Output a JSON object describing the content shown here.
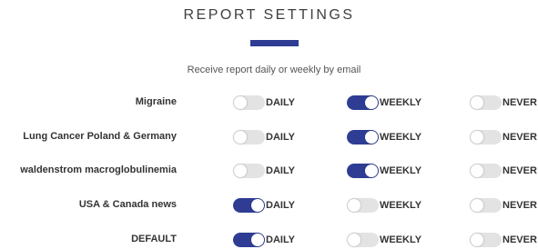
{
  "header": {
    "title": "REPORT SETTINGS",
    "subtitle": "Receive report daily or weekly by email"
  },
  "colors": {
    "accent": "#2e3d93",
    "toggle_on": "#2e3d93",
    "toggle_off": "#e3e3e3"
  },
  "options": [
    "DAILY",
    "WEEKLY",
    "NEVER"
  ],
  "rows": [
    {
      "label": "Migraine",
      "selected": "WEEKLY"
    },
    {
      "label": "Lung Cancer Poland & Germany",
      "selected": "WEEKLY"
    },
    {
      "label": "waldenstrom macroglobulinemia",
      "selected": "WEEKLY"
    },
    {
      "label": "USA & Canada news",
      "selected": "DAILY"
    },
    {
      "label": "DEFAULT",
      "selected": "DAILY"
    }
  ]
}
